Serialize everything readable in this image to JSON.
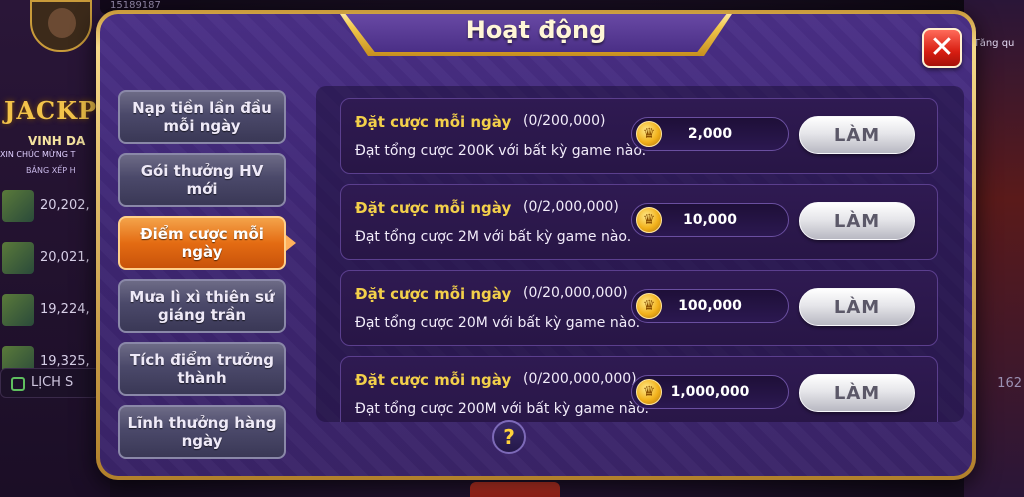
{
  "background": {
    "user_id": "15189187",
    "jackpot_label": "JACKP",
    "winner_name": "VINH DA",
    "congrats_text": "XIN CHÚC MỪNG T",
    "rank_label": "BẢNG XẾP H",
    "rank_values": [
      "20,202,",
      "20,021,",
      "19,224,",
      "19,325,"
    ],
    "history_label": "LỊCH S",
    "deposit_label": "Tăng qu",
    "count_right": "162"
  },
  "modal": {
    "title": "Hoạt động",
    "close_icon": "close-icon",
    "help_label": "?"
  },
  "sidebar": {
    "items": [
      {
        "label": "Nạp tiền lần đầu mỗi ngày",
        "active": false
      },
      {
        "label": "Gói thưởng HV mới",
        "active": false
      },
      {
        "label": "Điểm cược mỗi ngày",
        "active": true
      },
      {
        "label": "Mưa lì xì thiên sứ giáng trần",
        "active": false
      },
      {
        "label": "Tích điểm trưởng thành",
        "active": false
      },
      {
        "label": "Lĩnh thưởng hàng ngày",
        "active": false
      }
    ]
  },
  "tasks": [
    {
      "title": "Đặt cược mỗi ngày",
      "progress": "(0/200,000)",
      "desc": "Đạt tổng cược 200K với bất kỳ game nào.",
      "reward": "2,000",
      "button": "LÀM"
    },
    {
      "title": "Đặt cược mỗi ngày",
      "progress": "(0/2,000,000)",
      "desc": "Đạt tổng cược 2M với bất kỳ game nào.",
      "reward": "10,000",
      "button": "LÀM"
    },
    {
      "title": "Đặt cược mỗi ngày",
      "progress": "(0/20,000,000)",
      "desc": "Đạt tổng cược 20M với bất kỳ game nào.",
      "reward": "100,000",
      "button": "LÀM"
    },
    {
      "title": "Đặt cược mỗi ngày",
      "progress": "(0/200,000,000)",
      "desc": "Đạt tổng cược 200M với bất kỳ game nào.",
      "reward": "1,000,000",
      "button": "LÀM"
    }
  ],
  "colors": {
    "accent_gold": "#f3d04a",
    "active_tab": "#e46c13",
    "panel_purple": "#3d2672",
    "close_red": "#d81e12"
  }
}
